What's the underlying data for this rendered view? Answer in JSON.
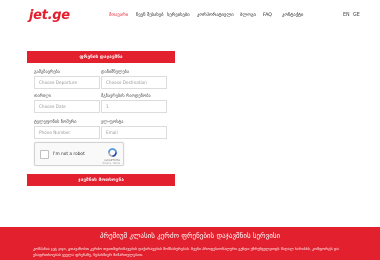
{
  "header": {
    "logo": "jet.ge",
    "nav": [
      {
        "label": "მთავარი",
        "active": true
      },
      {
        "label": "ჩვენ შესახებ",
        "active": false
      },
      {
        "label": "სერვისები",
        "active": false
      },
      {
        "label": "კორპორატიული",
        "active": false
      },
      {
        "label": "ბლოგი",
        "active": false
      },
      {
        "label": "FAQ",
        "active": false
      },
      {
        "label": "კონტაქტი",
        "active": false
      }
    ],
    "languages": [
      "EN",
      "GE"
    ]
  },
  "form": {
    "title": "ფრენის დაჯავშნა",
    "departure": {
      "label": "გამგზავრება",
      "placeholder": "Choose Departure"
    },
    "destination": {
      "label": "დანიშნულება",
      "placeholder": "Choose Destination"
    },
    "date": {
      "label": "თარიღი",
      "placeholder": "Choose Date"
    },
    "passengers": {
      "label": "მგზავრების რაოდენობა",
      "value": "1"
    },
    "phone": {
      "label": "ტელეფონის ნომერი",
      "placeholder": "Phone Number"
    },
    "email": {
      "label": "ელ-ფოსტა",
      "placeholder": "Email"
    },
    "captcha": {
      "text": "I'm not a robot",
      "brand": "reCAPTCHA",
      "links": "Privacy - Terms"
    },
    "submit_label": "ჯავშნის მოთხოვნა"
  },
  "banner": {
    "title": "პრემიუმ კლასის კერძო ფრენების დაჯავშნის სერვისი",
    "text": "კომპანია ჯეტ ჯიჯი, გთავაზობთ კერძო თვითმფრინავების დაქირავების მომსახურებას. ჩვენი პროფესიონალური გუნდი უზრუნველყოფს მაღალ ხარისხს, კომფორტს და უსაფრთხოებას ყველა ფრენაზე, ნებისმიერ მიმართულებით."
  },
  "colors": {
    "accent": "#e3202e"
  }
}
